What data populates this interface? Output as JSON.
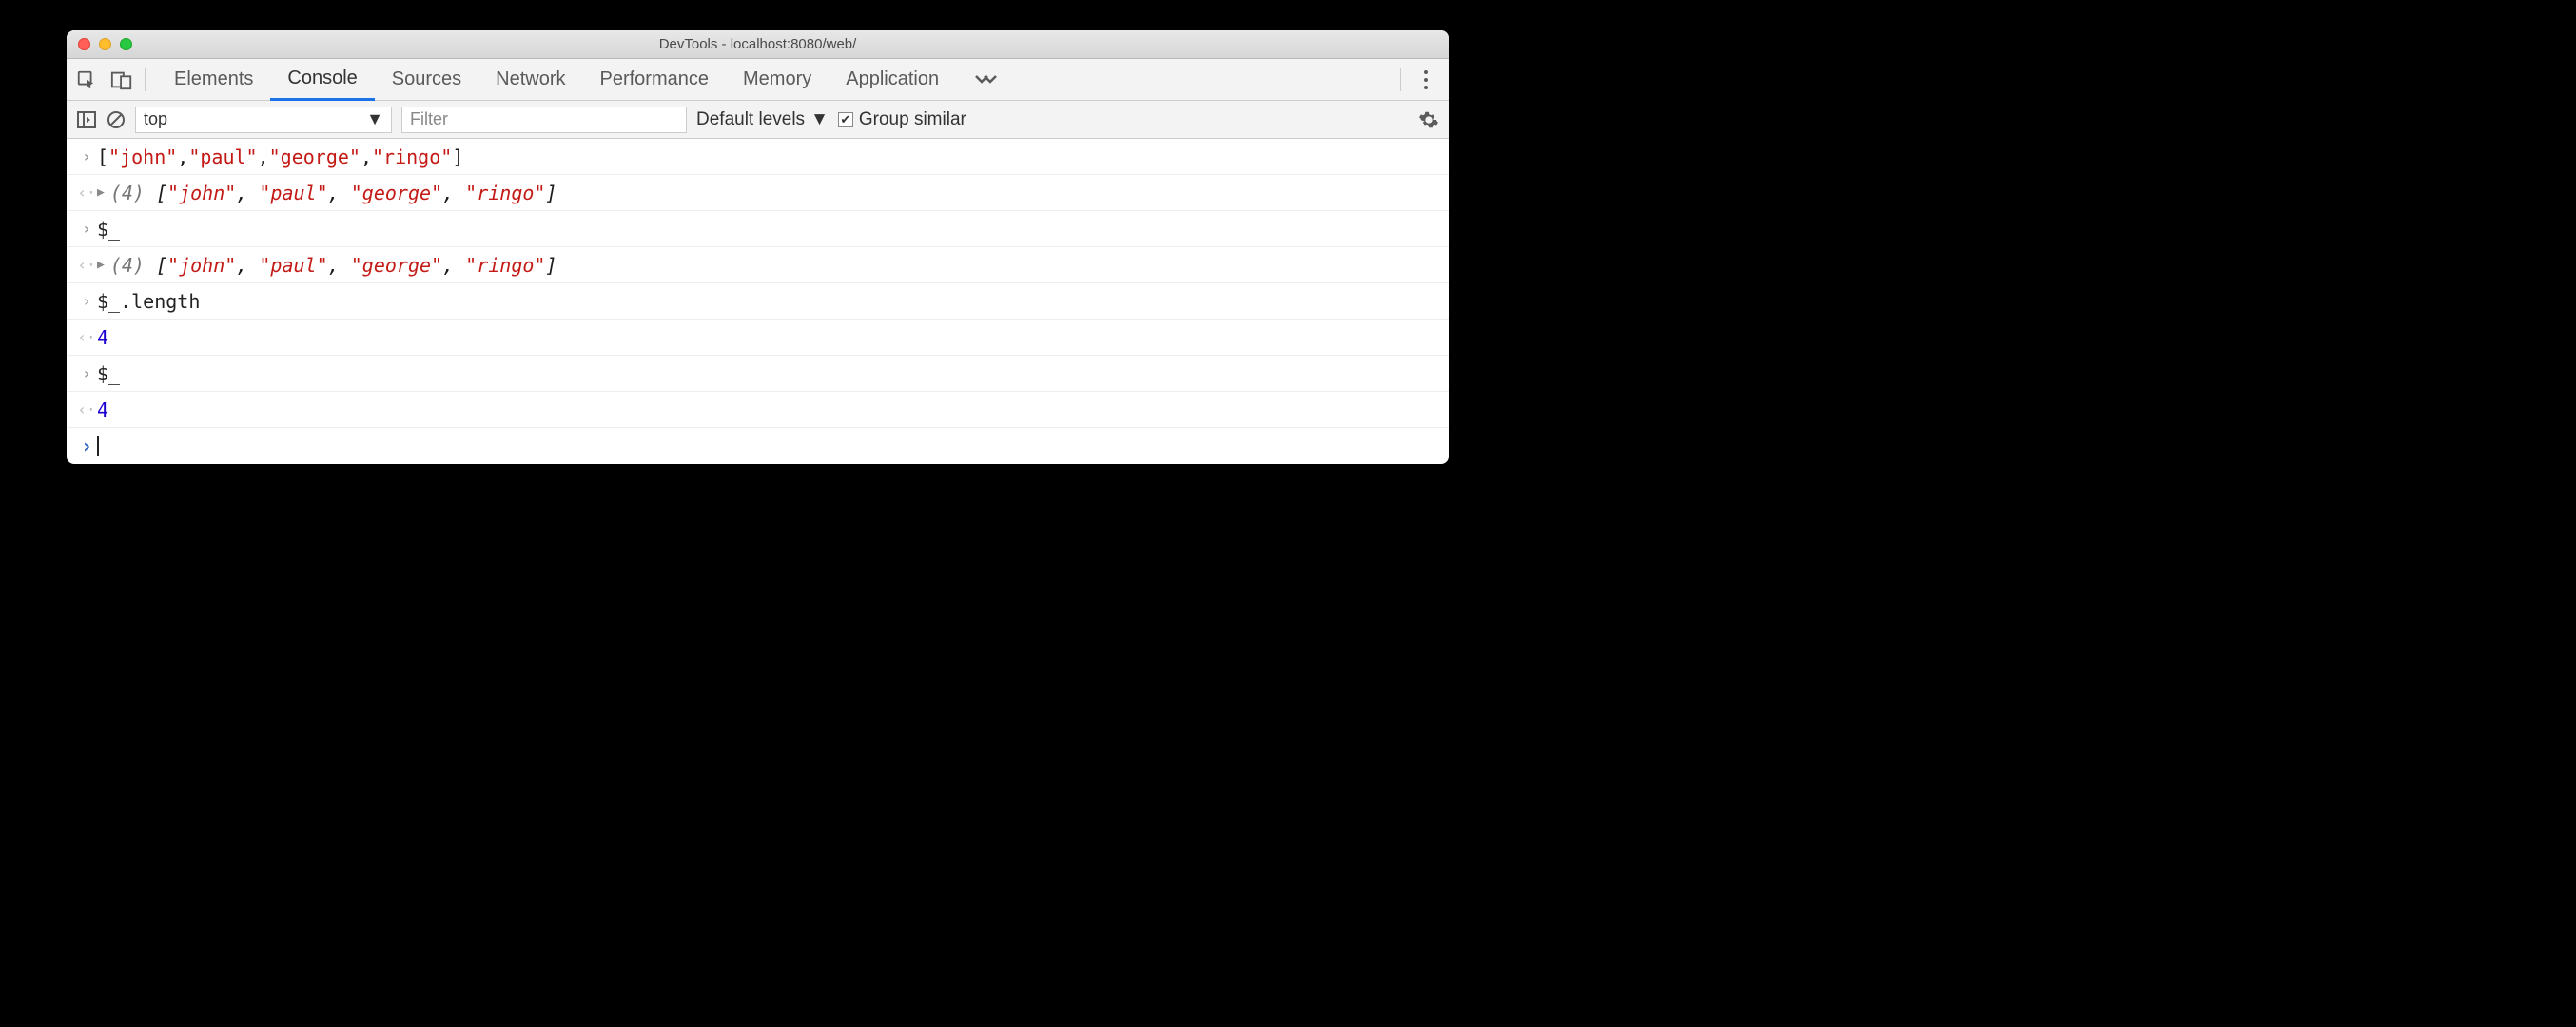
{
  "window": {
    "title": "DevTools - localhost:8080/web/"
  },
  "tabs": {
    "elements": "Elements",
    "console": "Console",
    "sources": "Sources",
    "network": "Network",
    "performance": "Performance",
    "memory": "Memory",
    "application": "Application"
  },
  "subbar": {
    "context": "top",
    "filter_placeholder": "Filter",
    "levels_label": "Default levels",
    "group_label": "Group similar"
  },
  "rows": {
    "r1_input": "[\"john\",\"paul\",\"george\",\"ringo\"]",
    "r2_count": "(4) ",
    "r2_array": "[\"john\", \"paul\", \"george\", \"ringo\"]",
    "r3_input": "$_",
    "r4_count": "(4) ",
    "r4_array": "[\"john\", \"paul\", \"george\", \"ringo\"]",
    "r5_input": "$_.length",
    "r6_output": "4",
    "r7_input": "$_",
    "r8_output": "4"
  }
}
